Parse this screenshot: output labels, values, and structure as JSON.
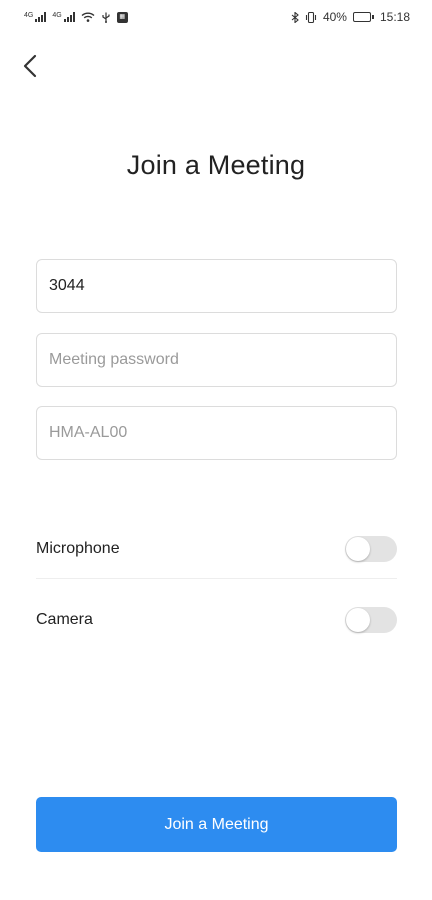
{
  "status_bar": {
    "signal_1_tag": "4G",
    "signal_2_tag": "4G",
    "battery_percent": "40%",
    "battery_level": 0.4,
    "time": "15:18",
    "icons": [
      "signal-icon",
      "signal-icon",
      "wifi-icon",
      "usb-icon",
      "notification-icon",
      "bluetooth-icon",
      "vibrate-icon",
      "battery-icon"
    ]
  },
  "nav": {
    "back_icon": "chevron-left-icon"
  },
  "page": {
    "title": "Join a Meeting"
  },
  "form": {
    "meeting_id": {
      "value": "3044",
      "placeholder": ""
    },
    "password": {
      "value": "",
      "placeholder": "Meeting password"
    },
    "display_name": {
      "value": "",
      "placeholder": "HMA-AL00"
    }
  },
  "toggles": {
    "microphone": {
      "label": "Microphone",
      "on": false
    },
    "camera": {
      "label": "Camera",
      "on": false
    }
  },
  "actions": {
    "join_label": "Join a Meeting"
  },
  "colors": {
    "accent": "#2d8cf0",
    "switch_off": "#e3e3e3",
    "border": "#dcdcdc",
    "placeholder": "#9a9a9a"
  }
}
